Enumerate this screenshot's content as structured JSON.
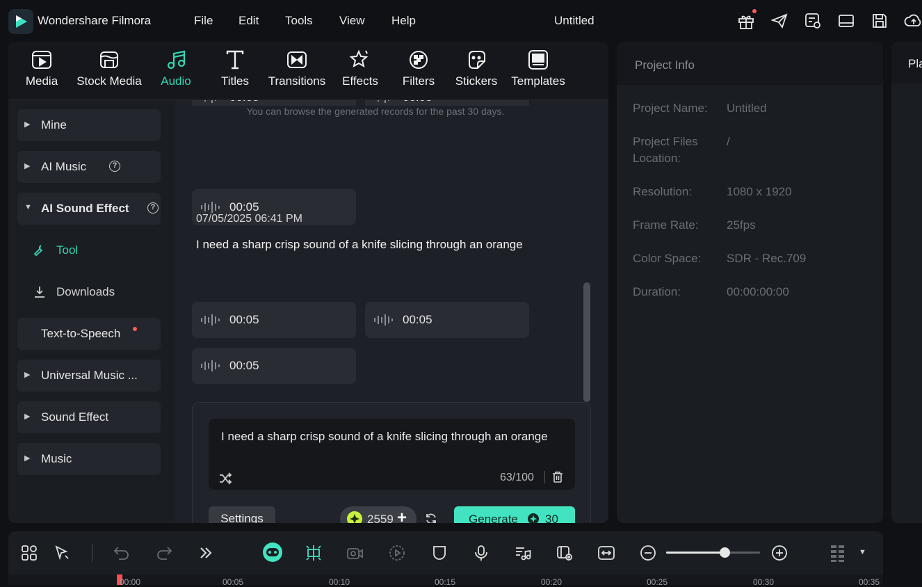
{
  "app": {
    "name": "Wondershare Filmora",
    "doc_title": "Untitled"
  },
  "menu": [
    "File",
    "Edit",
    "Tools",
    "View",
    "Help"
  ],
  "toolbar": [
    {
      "label": "Media",
      "icon": "media-icon"
    },
    {
      "label": "Stock Media",
      "icon": "stock-media-icon"
    },
    {
      "label": "Audio",
      "icon": "audio-icon",
      "active": true
    },
    {
      "label": "Titles",
      "icon": "titles-icon"
    },
    {
      "label": "Transitions",
      "icon": "transitions-icon"
    },
    {
      "label": "Effects",
      "icon": "effects-icon"
    },
    {
      "label": "Filters",
      "icon": "filters-icon"
    },
    {
      "label": "Stickers",
      "icon": "stickers-icon"
    },
    {
      "label": "Templates",
      "icon": "templates-icon"
    }
  ],
  "sidebar": {
    "mine": "Mine",
    "ai_music": "AI Music",
    "ai_sound_effect": "AI Sound Effect",
    "tool": "Tool",
    "downloads": "Downloads",
    "tts": "Text-to-Speech",
    "universal_music": "Universal Music ...",
    "sound_effect": "Sound Effect",
    "music": "Music"
  },
  "content": {
    "hint": "You can browse the generated records for the past 30 days.",
    "clip_duration": "00:05",
    "timestamp": "07/05/2025 06:41 PM",
    "prompt_title": "I need a sharp crisp sound of a knife slicing through an orange"
  },
  "generator": {
    "prompt": "I need a sharp crisp sound of a knife slicing through an orange",
    "char_count": "63/100",
    "settings": "Settings",
    "credits": "2559",
    "plus": "+",
    "generate": "Generate",
    "cost": "30"
  },
  "project_info": {
    "title": "Project Info",
    "rows": [
      {
        "label": "Project Name:",
        "value": "Untitled"
      },
      {
        "label": "Project Files Location:",
        "value": "/"
      },
      {
        "label": "Resolution:",
        "value": "1080 x 1920"
      },
      {
        "label": "Frame Rate:",
        "value": "25fps"
      },
      {
        "label": "Color Space:",
        "value": "SDR - Rec.709"
      },
      {
        "label": "Duration:",
        "value": "00:00:00:00"
      }
    ]
  },
  "player": {
    "title": "Pla"
  },
  "zoom": {
    "level": 0.62
  },
  "ruler": [
    "00:00",
    "00:05",
    "00:10",
    "00:15",
    "00:20",
    "00:25",
    "00:30",
    "00:35"
  ],
  "colors": {
    "accent": "#35d6b2",
    "generate": "#42e3c0",
    "notification": "#ff5b5b"
  }
}
